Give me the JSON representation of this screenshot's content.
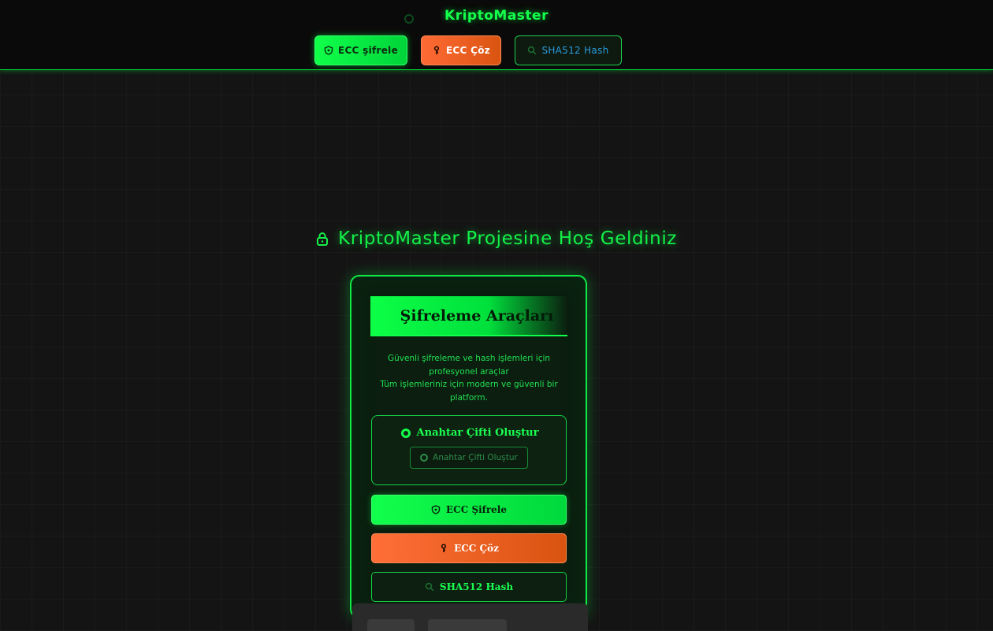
{
  "header": {
    "brand": "KriptoMaster",
    "nav": {
      "encrypt_label": "ECC şifrele",
      "decrypt_label": "ECC Çöz",
      "hash_label": "SHA512 Hash"
    }
  },
  "main": {
    "welcome_title": "KriptoMaster Projesine Hoş Geldiniz",
    "card": {
      "title": "Şifreleme Araçları",
      "description_line1": "Güvenli şifreleme ve hash işlemleri için profesyonel araçlar",
      "description_line2": "Tüm işlemleriniz için modern ve güvenli bir platform.",
      "keygen": {
        "title": "Anahtar Çifti Oluştur",
        "button_label": "Anahtar Çifti Oluştur"
      },
      "actions": {
        "encrypt_label": "ECC Şifrele",
        "decrypt_label": "ECC Çöz",
        "hash_label": "SHA512 Hash"
      }
    }
  },
  "colors": {
    "accent_green": "#00ff44",
    "accent_orange": "#ff6a35",
    "hash_blue": "#2a9bdb",
    "background": "#141414"
  },
  "icons": [
    "shield-icon",
    "key-icon",
    "search-icon",
    "lock-icon",
    "radio-icon"
  ]
}
